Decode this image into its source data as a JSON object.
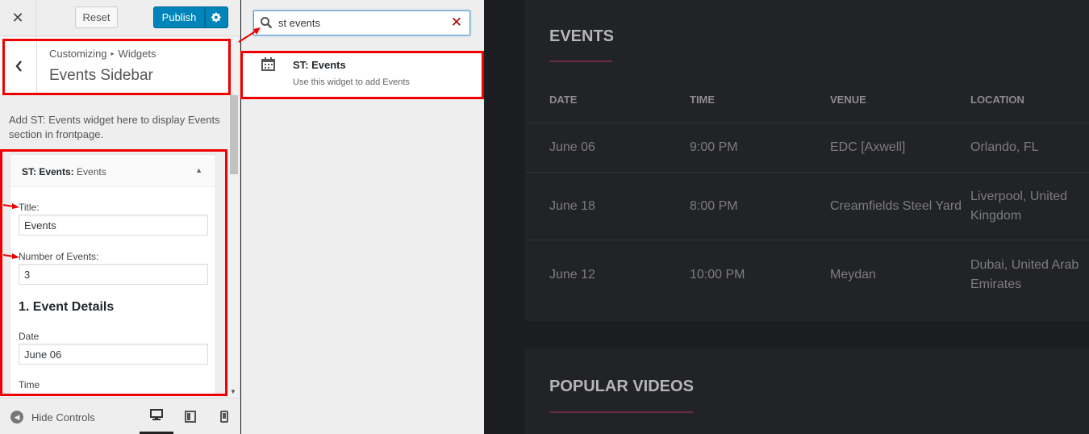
{
  "header": {
    "reset_label": "Reset",
    "publish_label": "Publish"
  },
  "section": {
    "breadcrumb_parent": "Customizing",
    "breadcrumb_current": "Widgets",
    "title": "Events Sidebar",
    "description": "Add ST: Events widget here to display Events section in frontpage."
  },
  "widget": {
    "name": "ST: Events:",
    "name_suffix": "Events",
    "title_label": "Title:",
    "title_value": "Events",
    "count_label": "Number of Events:",
    "count_value": "3",
    "event_heading": "1. Event Details",
    "date_label": "Date",
    "date_value": "June 06",
    "time_label": "Time"
  },
  "footer": {
    "hide_controls_label": "Hide Controls"
  },
  "search": {
    "value": "st events"
  },
  "result": {
    "title": "ST: Events",
    "description": "Use this widget to add Events"
  },
  "preview": {
    "events_title": "EVENTS",
    "columns": [
      "DATE",
      "TIME",
      "VENUE",
      "LOCATION"
    ],
    "rows": [
      {
        "date": "June 06",
        "time": "9:00 PM",
        "venue": "EDC [Axwell]",
        "location": "Orlando, FL"
      },
      {
        "date": "June 18",
        "time": "8:00 PM",
        "venue": "Creamfields Steel Yard",
        "location": "Liverpool, United Kingdom"
      },
      {
        "date": "June 12",
        "time": "10:00 PM",
        "venue": "Meydan",
        "location": "Dubai, United Arab Emirates"
      }
    ],
    "videos_title": "POPULAR VIDEOS"
  },
  "colors": {
    "accent": "#0085ba",
    "annotation": "#ee0000",
    "preview_bg": "#1c1d20",
    "underline": "#6b2c3f"
  }
}
